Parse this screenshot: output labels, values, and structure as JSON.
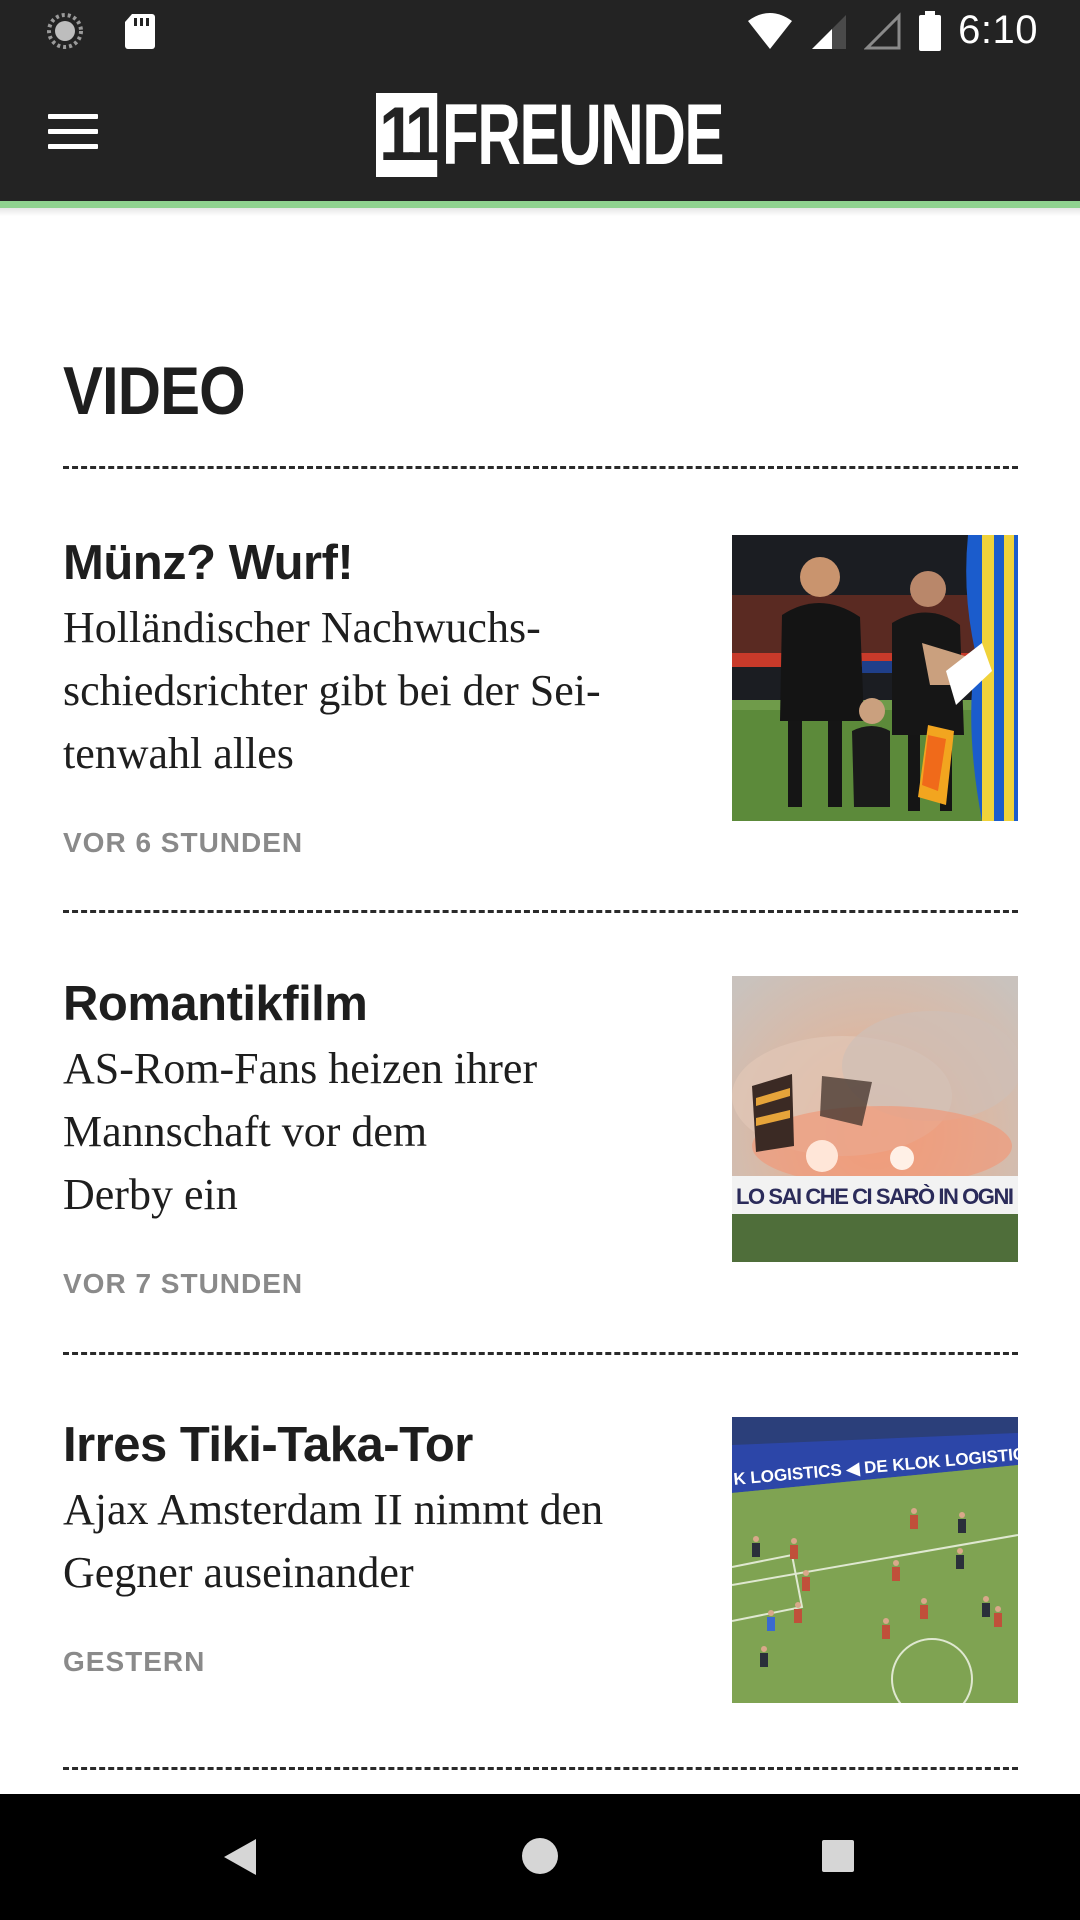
{
  "status_bar": {
    "time": "6:10",
    "icons": [
      "loading-icon",
      "sd-card-icon",
      "wifi-icon",
      "signal-icon",
      "signal-empty-icon",
      "battery-icon"
    ]
  },
  "app_bar": {
    "logo_number": "11",
    "logo_text": "FREUNDE",
    "background": "#232323",
    "accent": "#8fd28f"
  },
  "section": {
    "title": "VIDEO"
  },
  "articles": [
    {
      "kicker": "Münz? Wurf!",
      "headline_lines": [
        "Holländischer Nachwuchs-",
        "schiedsrichter gibt bei der Sei-",
        "tenwahl alles"
      ],
      "time": "VOR 6 STUNDEN",
      "thumbnail": "referees-coin-toss-photo"
    },
    {
      "kicker": "Romantikfilm",
      "headline_lines": [
        "AS-Rom-Fans heizen ihrer",
        "Mannschaft vor dem",
        "Derby ein"
      ],
      "time": "VOR 7 STUNDEN",
      "thumbnail": "fans-pyro-photo",
      "banner_text": "LO SAI CHE CI SARÒ IN OGNI"
    },
    {
      "kicker": "Irres Tiki-Taka-Tor",
      "headline_lines": [
        "Ajax Amsterdam II nimmt den",
        "Gegner auseinander"
      ],
      "time": "GESTERN",
      "thumbnail": "football-match-photo",
      "banner_text": "K LOGISTICS  ◀ DE KLOK LOGISTICS  ◀ DE K"
    }
  ],
  "nav_bar": {
    "buttons": [
      "back-icon",
      "home-icon",
      "recents-icon"
    ]
  }
}
